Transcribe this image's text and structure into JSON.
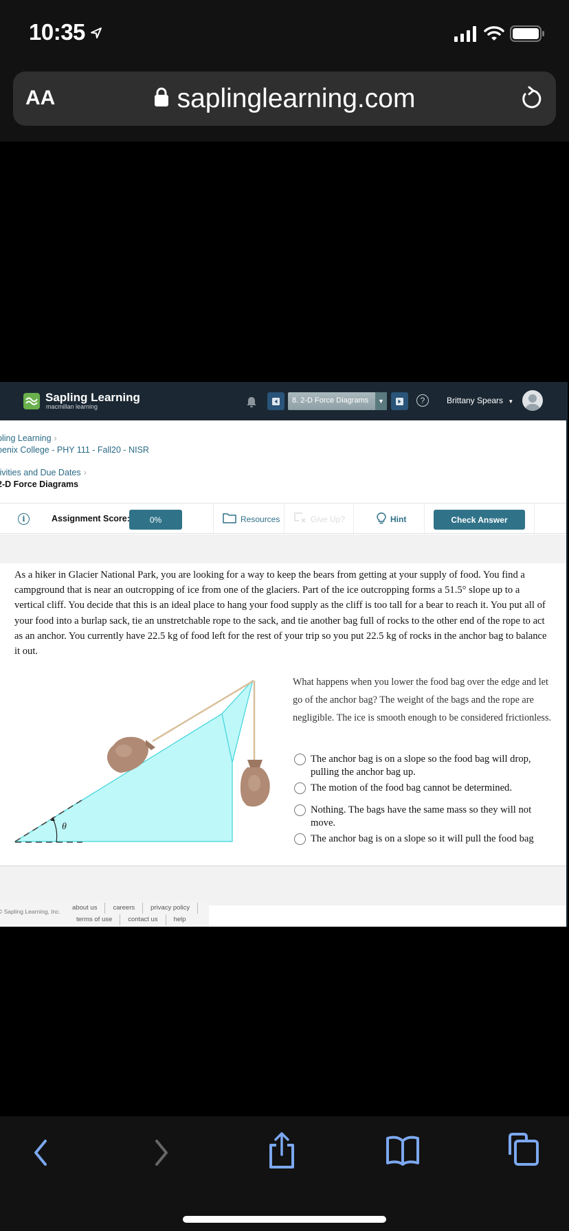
{
  "status_bar": {
    "time": "10:35",
    "icons": [
      "location-arrow-icon",
      "cellular-signal-icon",
      "wifi-icon",
      "battery-icon"
    ]
  },
  "browser": {
    "text_size_label": "AA",
    "url": "saplinglearning.com",
    "icons": [
      "lock-icon",
      "reload-icon"
    ],
    "toolbar": [
      "back-icon",
      "forward-icon",
      "share-icon",
      "bookmarks-icon",
      "tabs-icon"
    ]
  },
  "navbar": {
    "brand_title": "Sapling Learning",
    "brand_subtitle": "macmillan learning",
    "assignment_select": "8. 2-D Force Diagrams",
    "user_name": "Brittany Spears",
    "colors": {
      "navbar_bg": "#1b2833",
      "nav_button": "#2a5479",
      "logo_green": "#6ab04c"
    }
  },
  "breadcrumbs": {
    "row1": [
      {
        "label": "pling Learning",
        "link": true
      },
      {
        "label": "oenix College - PHY 111 - Fall20 - NISR",
        "link": true
      }
    ],
    "row2": [
      {
        "label": "tivities and Due Dates",
        "link": true
      },
      {
        "label": "2-D Force Diagrams",
        "link": false
      }
    ]
  },
  "toolbar": {
    "score_label": "Assignment Score:",
    "score_value": "0%",
    "resources_label": "Resources",
    "give_up_label": "Give Up?",
    "hint_label": "Hint",
    "check_answer_label": "Check Answer",
    "accent_color": "#307389"
  },
  "question": {
    "prompt": "As a hiker in Glacier National Park, you are looking for a way to keep the bears from getting at your supply of food. You find a campground that is near an outcropping of ice from one of the glaciers. Part of the ice outcropping forms a 51.5° slope up to a vertical cliff. You decide that this is an ideal place to hang your food supply as the cliff is too tall for a bear to reach it. You put all of your food into a burlap sack, tie an unstretchable rope to the sack, and tie another bag full of rocks to the other end of the rope to act as an anchor. You currently have 22.5 kg of food left for the rest of your trip so you put 22.5 kg of rocks in the anchor bag to balance it out.",
    "figure": {
      "angle_label": "θ",
      "ice_color": "#bff8f8",
      "ice_edge": "#3fd3dc",
      "rope_color": "#d8c09a",
      "bag_color": "#b08a74"
    },
    "sub_question": "What happens when you lower the food bag over the edge and let go of the anchor bag? The weight of the bags and the rope are negligible. The ice is smooth enough to be considered frictionless.",
    "options": [
      "The anchor bag is on a slope so the food bag will drop, pulling the anchor bag up.",
      "The motion of the food bag cannot be determined.",
      "Nothing. The bags have the same mass so they will not move.",
      "The anchor bag is on a slope so it will pull the food bag"
    ]
  },
  "footer": {
    "copyright": "© Sapling Learning, Inc.",
    "links_row1": [
      "about us",
      "careers",
      "privacy policy"
    ],
    "links_row2": [
      "terms of use",
      "contact us",
      "help"
    ]
  }
}
